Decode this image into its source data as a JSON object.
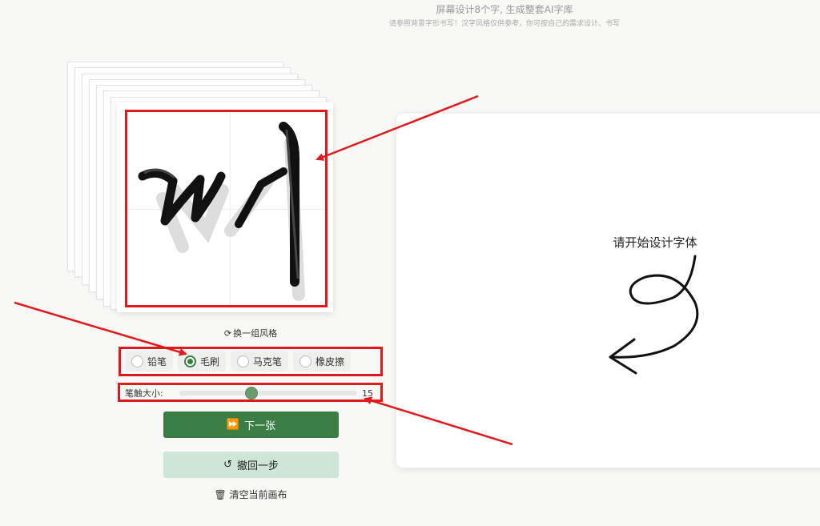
{
  "header": {
    "title": "屏幕设计8个字, 生成整套AI字库",
    "subtitle": "请参照背景字形书写！汉字风格仅供参考，你可按自己的需求设计、书写"
  },
  "reference": {
    "change_style_label": "换一组风格"
  },
  "tools": {
    "items": [
      {
        "label": "铅笔",
        "checked": false
      },
      {
        "label": "毛刷",
        "checked": true
      },
      {
        "label": "马克笔",
        "checked": false
      },
      {
        "label": "橡皮擦",
        "checked": false
      }
    ]
  },
  "brush": {
    "size_label": "笔触大小:",
    "size_value": "15",
    "size_fraction": 0.4
  },
  "actions": {
    "next_label": "下一张",
    "undo_label": "撤回一步",
    "clear_label": "清空当前画布"
  },
  "canvas": {
    "hint": "请开始设计字体"
  },
  "colors": {
    "accent": "#3a7d45",
    "accent_light": "#cde6d7",
    "highlight": "#e0191b"
  }
}
